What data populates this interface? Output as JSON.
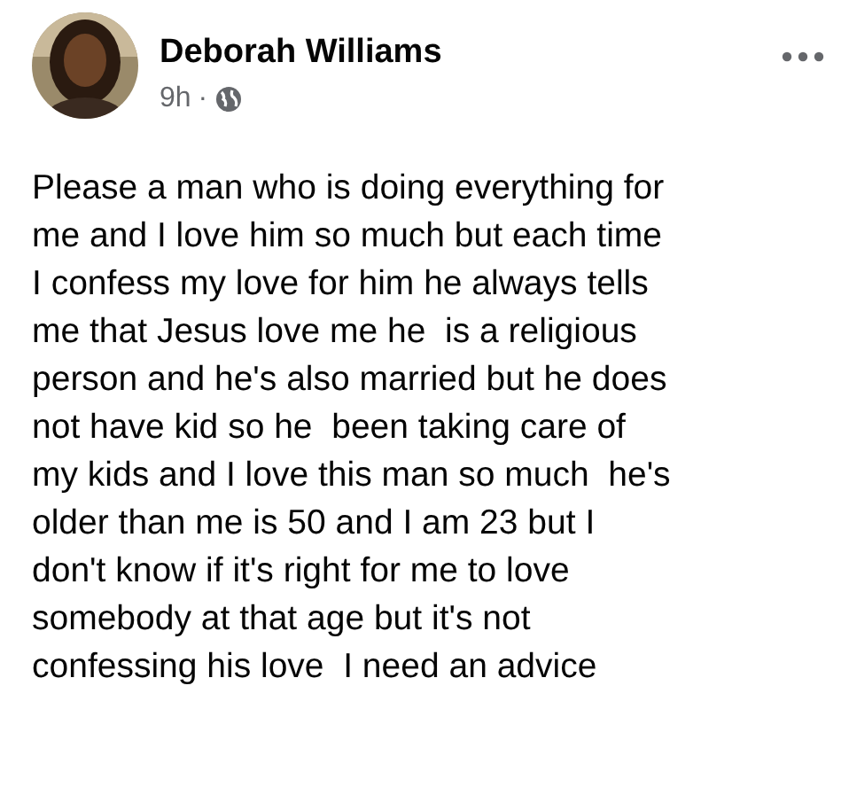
{
  "post": {
    "author": "Deborah Williams",
    "time": "9h",
    "separator": "·",
    "text_lines": [
      "Please a man who is doing everything for",
      "me and I love him so much but each time",
      "I confess my love for him he always tells",
      "me that Jesus love me he  is a religious",
      "person and he's also married but he does",
      "not have kid so he  been taking care of",
      "my kids and I love this man so much  he's",
      "older than me is 50 and I am 23 but I",
      "don't know if it's right for me to love",
      "somebody at that age but it's not",
      "confessing his love  I need an advice"
    ]
  }
}
